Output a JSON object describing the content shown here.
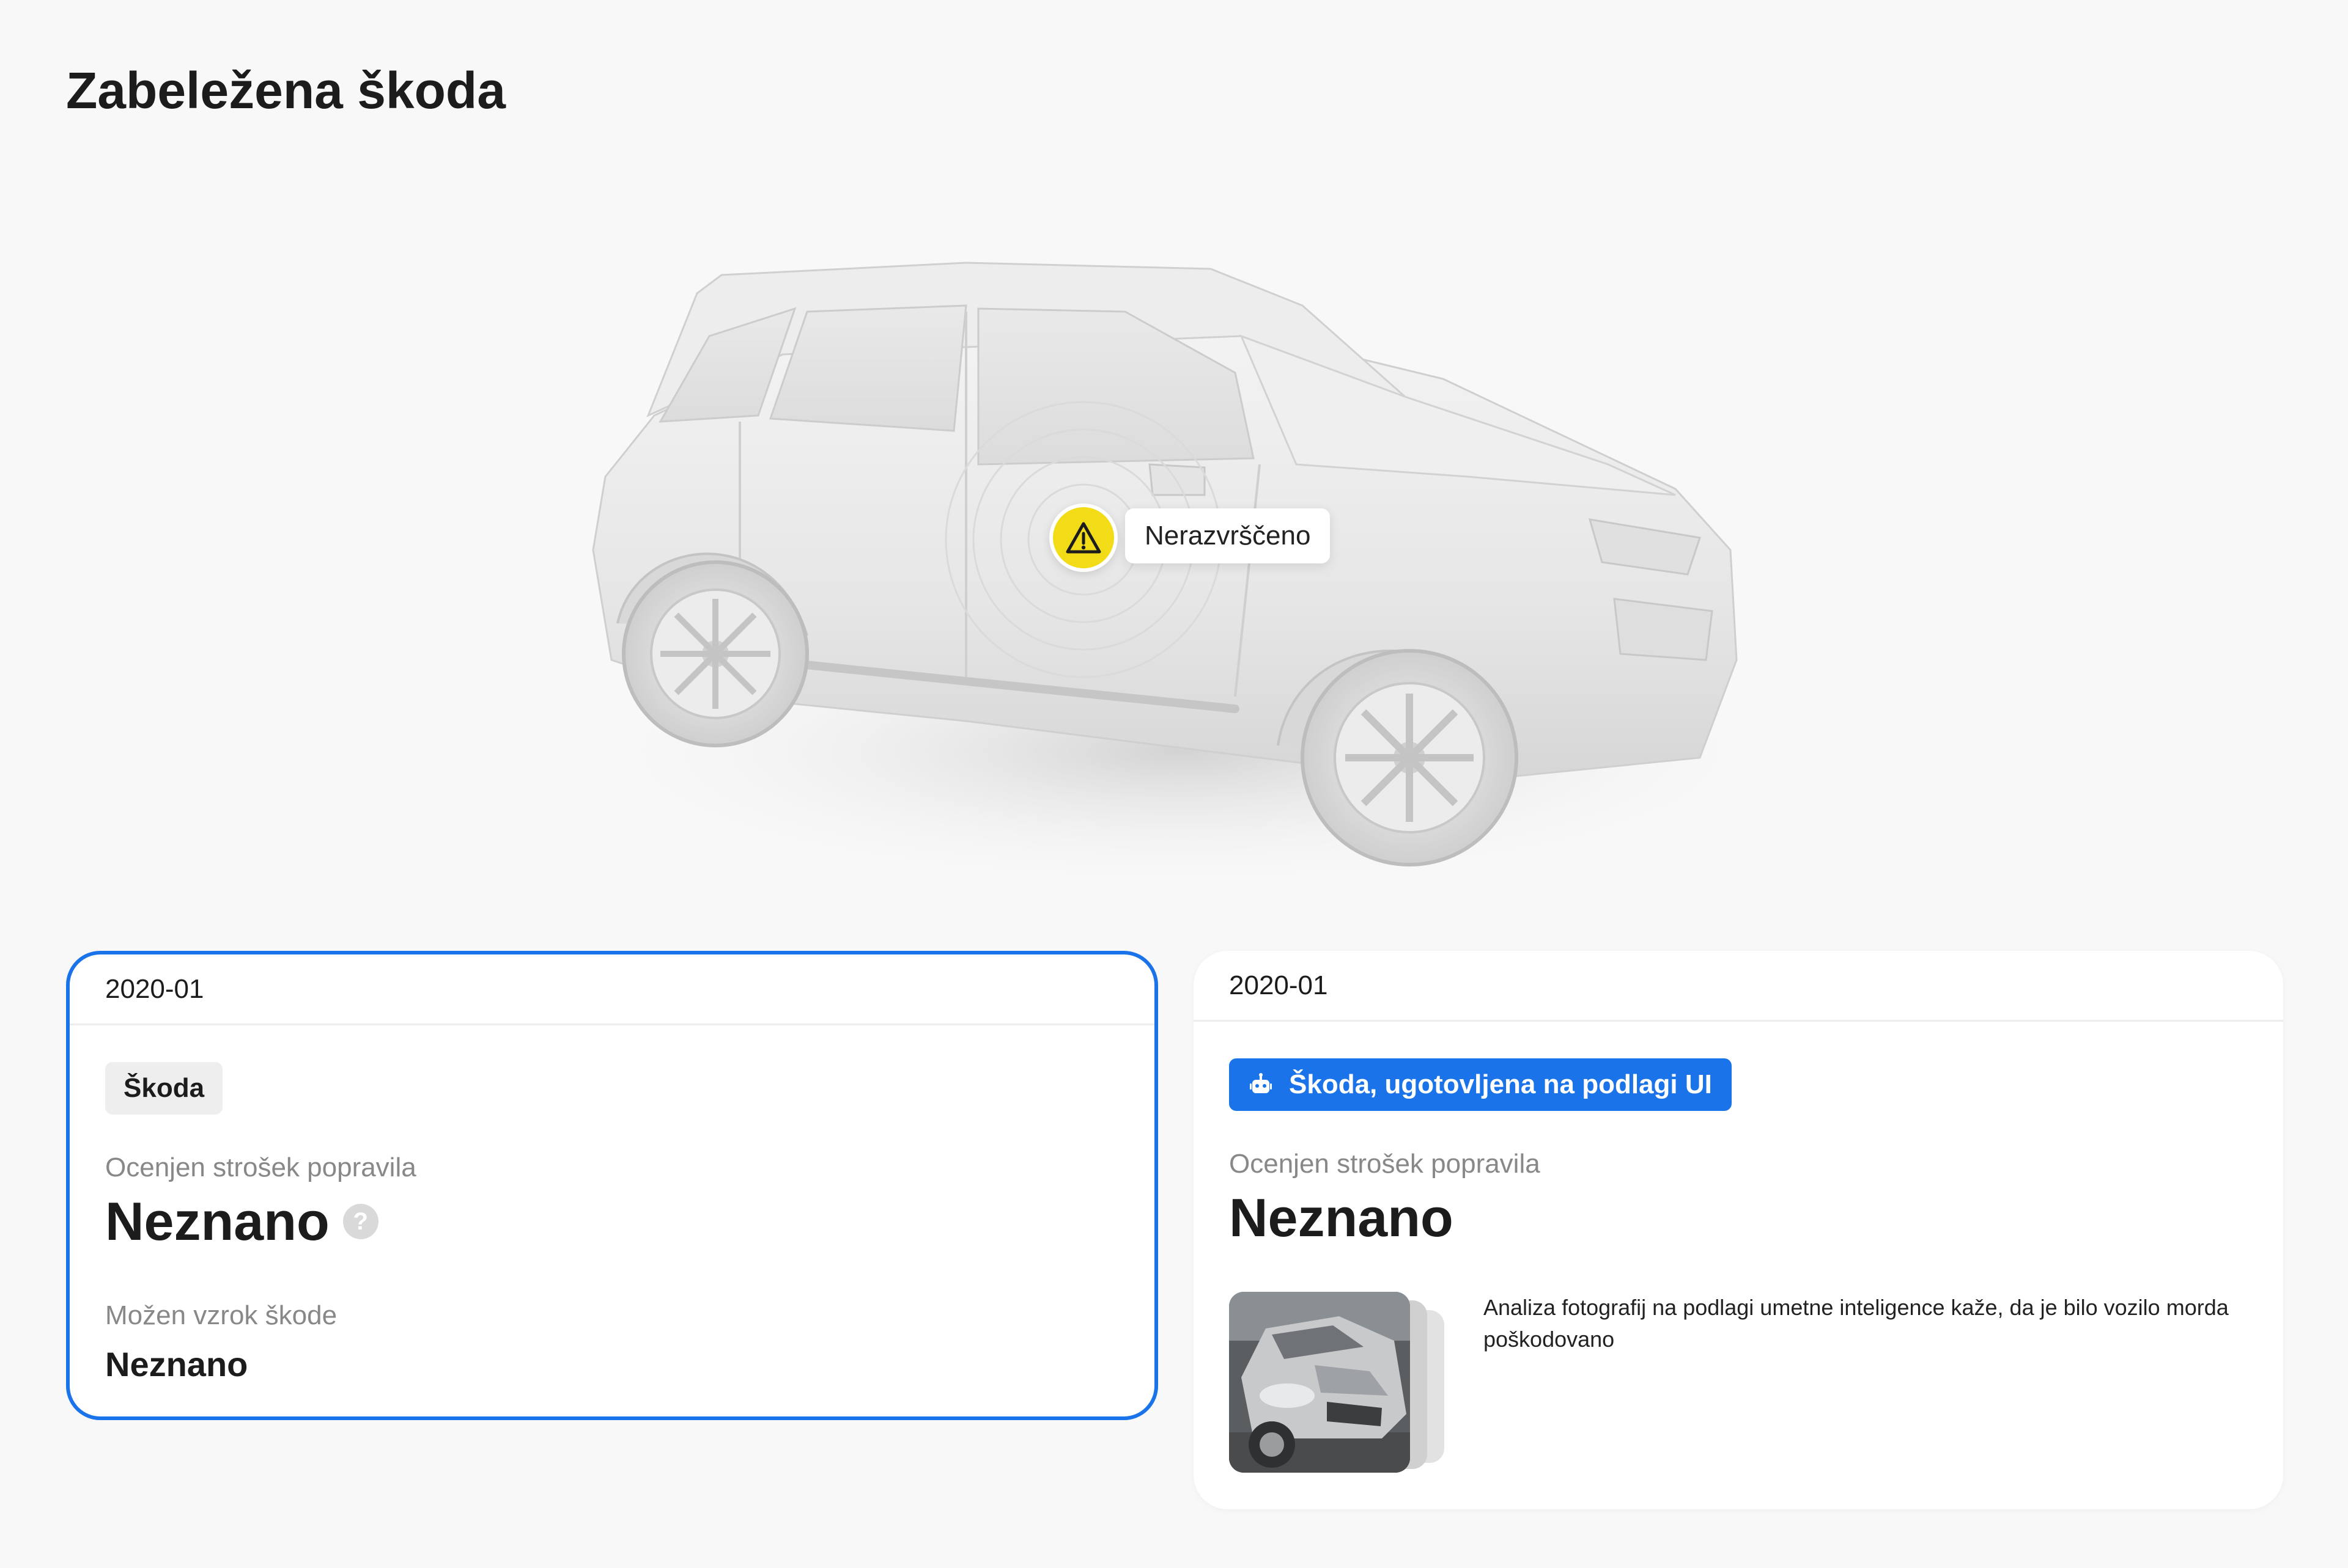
{
  "page": {
    "title": "Zabeležena škoda"
  },
  "marker": {
    "status_label": "Nerazvrščeno",
    "icon": "warning-icon"
  },
  "cards": [
    {
      "date": "2020-01",
      "tag": "Škoda",
      "cost_label": "Ocenjen strošek popravila",
      "cost_value": "Neznano",
      "help_icon": "?",
      "cause_label": "Možen vzrok škode",
      "cause_value": "Neznano"
    },
    {
      "date": "2020-01",
      "tag": "Škoda, ugotovljena na podlagi UI",
      "tag_icon": "robot-icon",
      "cost_label": "Ocenjen strošek popravila",
      "cost_value": "Neznano",
      "analysis": "Analiza fotografij na podlagi umetne inteligence kaže, da je bilo vozilo morda poškodovano"
    }
  ],
  "colors": {
    "accent": "#1a73e8",
    "warning": "#f2dc17",
    "background": "#f8f8f8"
  }
}
